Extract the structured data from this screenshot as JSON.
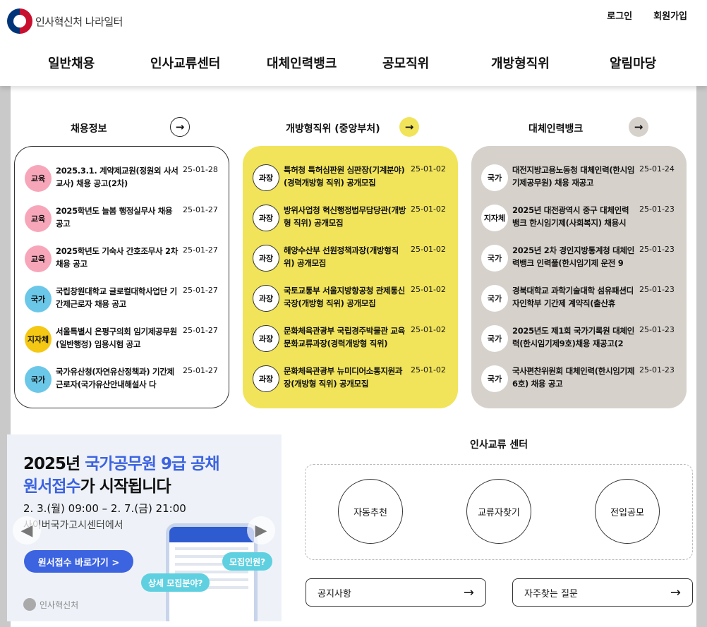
{
  "header": {
    "logo_text": "인사혁신처 나라일터",
    "login": "로그인",
    "signup": "회원가입",
    "nav": [
      "일반채용",
      "인사교류센터",
      "대체인력뱅크",
      "공모직위",
      "개방형직위",
      "알림마당"
    ]
  },
  "sections": {
    "recruit": {
      "title": "채용정보",
      "arrow": "→",
      "items": [
        {
          "badge": "교육",
          "title": "2025.3.1. 계약제교원(정원외 사서교사) 채용 공고(2차)",
          "date": "25-01-28"
        },
        {
          "badge": "교육",
          "title": "2025학년도 늘봄 행정실무사 채용 공고",
          "date": "25-01-27"
        },
        {
          "badge": "교육",
          "title": "2025학년도 기숙사 간호조무사 2차 채용 공고",
          "date": "25-01-27"
        },
        {
          "badge": "국가",
          "title": "국립창원대학교 글로컬대학사업단 기간제근로자 채용 공고",
          "date": "25-01-27"
        },
        {
          "badge": "지자체",
          "title": "서울특별시 은평구의회 임기제공무원(일반행정) 임용시험 공고",
          "date": "25-01-27"
        },
        {
          "badge": "국가",
          "title": "국가유산청(자연유산정책과) 기간제근로자(국가유산안내해설사 다",
          "date": "25-01-27"
        }
      ]
    },
    "open": {
      "title": "개방형직위 (중앙부처)",
      "arrow": "→",
      "items": [
        {
          "badge": "과장",
          "title": "특허청 특허심판원 심판장(기계분야)(경력개방형 직위) 공개모집",
          "date": "25-01-02"
        },
        {
          "badge": "과장",
          "title": "방위사업청 혁신행정법무담당관(개방형 직위) 공개모집",
          "date": "25-01-02"
        },
        {
          "badge": "과장",
          "title": "해양수산부 선원정책과장(개방형직위) 공개모집",
          "date": "25-01-02"
        },
        {
          "badge": "과장",
          "title": "국토교통부 서울지방항공청 관제통신국장(개방형 직위) 공개모집",
          "date": "25-01-02"
        },
        {
          "badge": "과장",
          "title": "문화체육관광부 국립경주박물관 교육문화교류과장(경력개방형 직위)",
          "date": "25-01-02"
        },
        {
          "badge": "과장",
          "title": "문화체육관광부 뉴미디어소통지원과장(개방형 직위) 공개모집",
          "date": "25-01-02"
        }
      ]
    },
    "substitute": {
      "title": "대체인력뱅크",
      "arrow": "→",
      "items": [
        {
          "badge": "국가",
          "title": "대전지방고용노동청 대체인력(한시임기제공무원) 채용 재공고",
          "date": "25-01-24"
        },
        {
          "badge": "지자체",
          "title": "2025년 대전광역시 중구 대체인력뱅크 한시임기제(사회복지) 채용시",
          "date": "25-01-23"
        },
        {
          "badge": "국가",
          "title": "2025년 2차 경인지방통계청 대체인력뱅크 인력풀(한시임기제 운전 9",
          "date": "25-01-23"
        },
        {
          "badge": "국가",
          "title": "경북대학교 과학기술대학 섬유패션디자인학부 기간제 계약직(출산휴",
          "date": "25-01-23"
        },
        {
          "badge": "국가",
          "title": "2025년도 제1회 국가기록원 대체인력(한시임기제9호)채용 재공고(2",
          "date": "25-01-23"
        },
        {
          "badge": "국가",
          "title": "국사편찬위원회 대체인력(한시임기제 6호) 채용 공고",
          "date": "25-01-23"
        }
      ]
    }
  },
  "banner": {
    "line1_a": "2025년 ",
    "line1_b": "국가공무원 9급 공채",
    "line2_a": "원서접수",
    "line2_b": "가 시작됩니다",
    "date": "2. 3.(월) 09:00 – 2. 7.(금) 21:00",
    "sub": "사이버국가고시센터에서",
    "button": "원서접수 바로가기 >",
    "logo": "인사혁신처",
    "bubble1": "모집인원?",
    "bubble2": "상세 모집분야?",
    "prev": "◀",
    "next": "▶"
  },
  "exchange": {
    "title": "인사교류 센터",
    "buttons": [
      "자동추천",
      "교류자찾기",
      "전입공모"
    ]
  },
  "links": {
    "notice": "공지사항",
    "faq": "자주찾는 질문",
    "arrow": "→"
  },
  "colors": {
    "open_card": "#f1e45a",
    "substitute_card": "#d6d1cb",
    "banner_blue": "#3c63e0"
  }
}
